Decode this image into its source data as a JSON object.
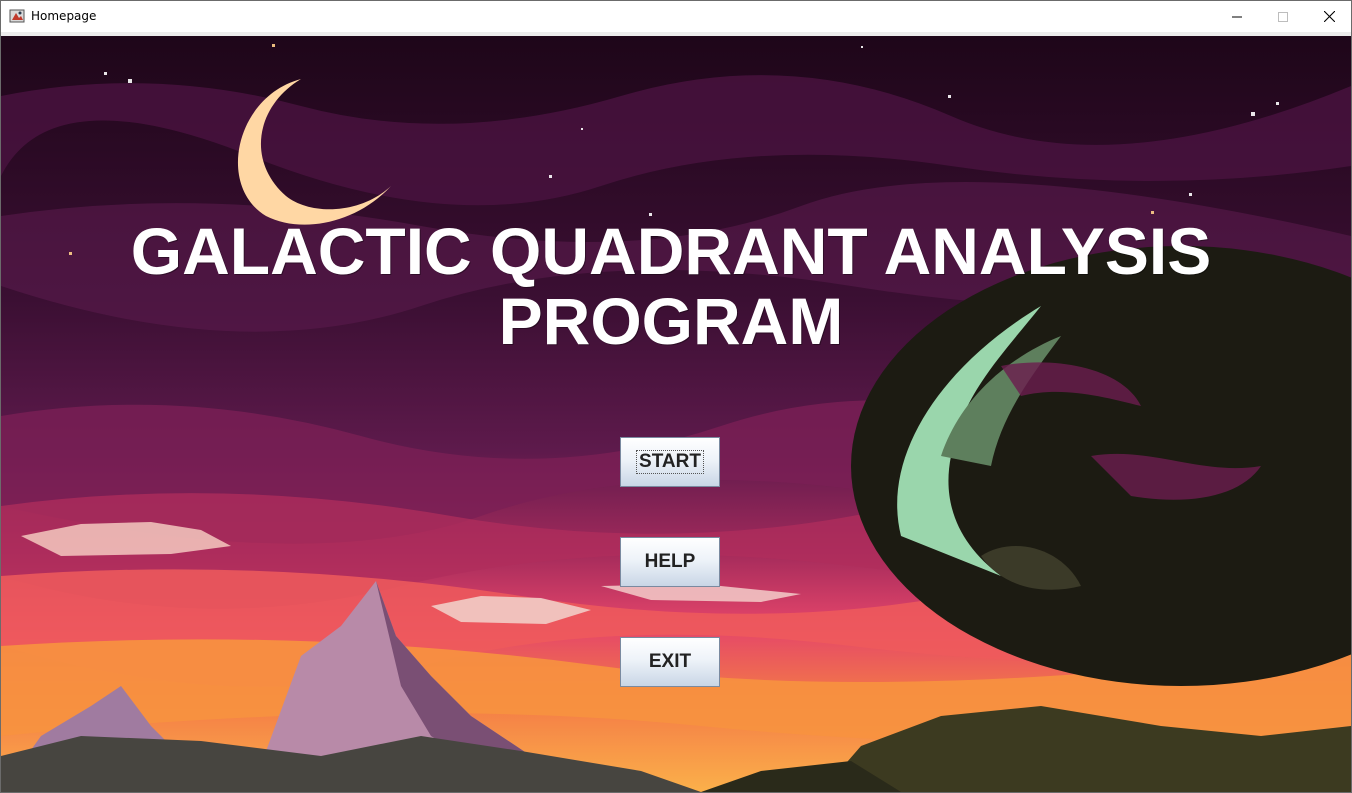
{
  "window": {
    "title": "Homepage",
    "controls": [
      "minimize-icon",
      "maximize-icon",
      "close-icon"
    ]
  },
  "main": {
    "title_line1": "GALACTIC QUADRANT ANALYSIS",
    "title_line2": "PROGRAM",
    "buttons": {
      "start": "START",
      "help": "HELP",
      "exit": "EXIT"
    }
  },
  "colors": {
    "sky_dark": "#2a0a22",
    "sky_purple": "#5c1848",
    "sunset_pink": "#e8466a",
    "sunset_orange": "#f7913b",
    "moon": "#ffd9a6",
    "planet_green": "#8fd1a8",
    "planet_dark": "#1b1a12"
  }
}
